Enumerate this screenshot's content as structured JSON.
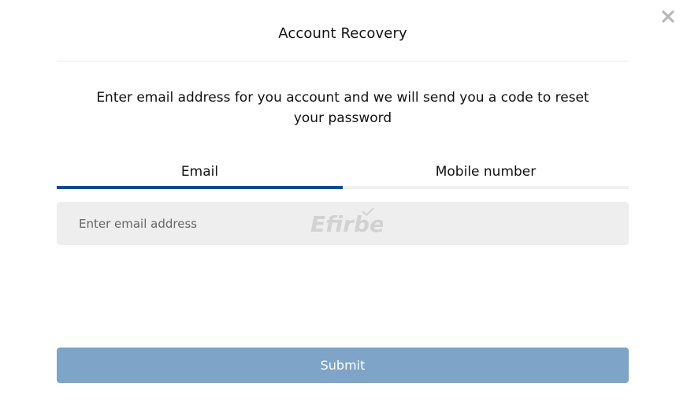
{
  "modal": {
    "title": "Account Recovery",
    "description": "Enter email address for you account and we will send you a code to reset your password"
  },
  "tabs": [
    {
      "label": "Email",
      "active": true
    },
    {
      "label": "Mobile number",
      "active": false
    }
  ],
  "email_field": {
    "value": "",
    "placeholder": "Enter email address"
  },
  "watermark": {
    "text": "Efirbet"
  },
  "submit": {
    "label": "Submit"
  },
  "icons": {
    "close": "close-icon"
  },
  "colors": {
    "active_tab_underline": "#0e4a8e",
    "submit_background": "#7ea4c7",
    "input_background": "#eeeeee"
  }
}
